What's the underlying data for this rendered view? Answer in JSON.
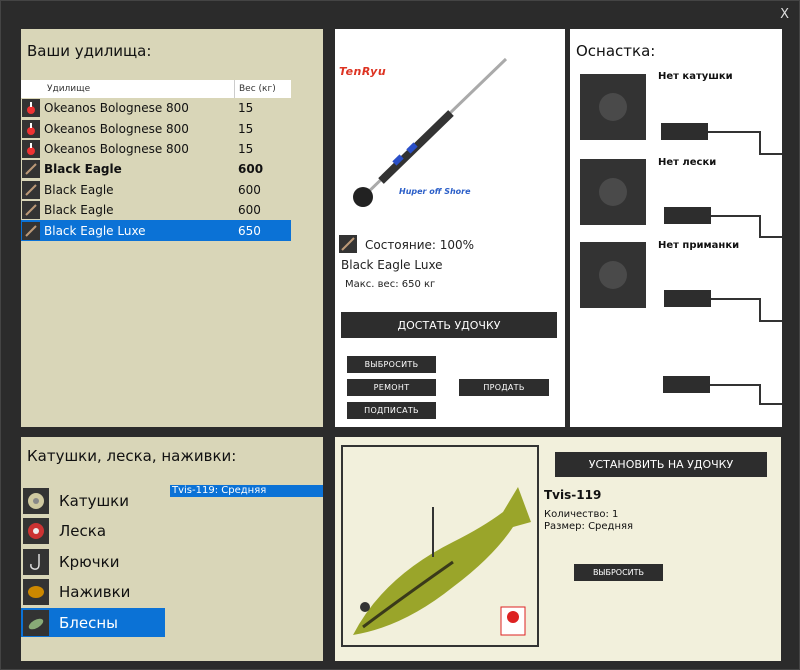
{
  "window": {
    "close_label": "X"
  },
  "rods": {
    "title": "Ваши удилища:",
    "col_name": "Удилище",
    "col_weight": "Вес (кг)",
    "rows": [
      {
        "name": "Okeanos Bolognese 800",
        "weight": "15",
        "icon": "float-rod-icon"
      },
      {
        "name": "Okeanos Bolognese 800",
        "weight": "15",
        "icon": "float-rod-icon"
      },
      {
        "name": "Okeanos Bolognese 800",
        "weight": "15",
        "icon": "float-rod-icon"
      },
      {
        "name": "Black Eagle",
        "weight": "600",
        "icon": "spinning-rod-icon"
      },
      {
        "name": "Black Eagle",
        "weight": "600",
        "icon": "spinning-rod-icon"
      },
      {
        "name": "Black Eagle",
        "weight": "600",
        "icon": "spinning-rod-icon"
      },
      {
        "name": "Black Eagle Luxe",
        "weight": "650",
        "icon": "spinning-rod-icon"
      }
    ]
  },
  "rod_view": {
    "brand_logo": "TenRyu",
    "brand_sub": "Huper off Shore",
    "condition": "Состояние: 100%",
    "name": "Black Eagle Luxe",
    "max_weight": "Макс. вес: 650 кг",
    "get_button": "ДОСТАТЬ УДОЧКУ",
    "drop_button": "ВЫБРОСИТЬ",
    "repair_button": "РЕМОНТ",
    "sign_button": "ПОДПИСАТЬ",
    "sell_button": "ПРОДАТЬ"
  },
  "tackle": {
    "title": "Оснастка:",
    "reel_label": "Нет катушки",
    "line_label": "Нет лески",
    "bait_label": "Нет приманки"
  },
  "lures": {
    "title": "Катушки, леска, наживки:",
    "categories": [
      {
        "label": "Катушки",
        "icon": "reel-icon"
      },
      {
        "label": "Леска",
        "icon": "line-spool-icon"
      },
      {
        "label": "Крючки",
        "icon": "hook-icon"
      },
      {
        "label": "Наживки",
        "icon": "bait-icon"
      },
      {
        "label": "Блесны",
        "icon": "lure-icon"
      }
    ],
    "selected_item": "Tvis-119: Средняя"
  },
  "detail": {
    "install_button": "УСТАНОВИТЬ НА УДОЧКУ",
    "name": "Tvis-119",
    "qty": "Количество: 1",
    "size": "Размер: Средняя",
    "drop_button": "ВЫБРОСИТЬ"
  },
  "colors": {
    "selection": "#0b72d6",
    "panel_beige": "#d9d6b8",
    "button_dark": "#2d2d2d"
  }
}
